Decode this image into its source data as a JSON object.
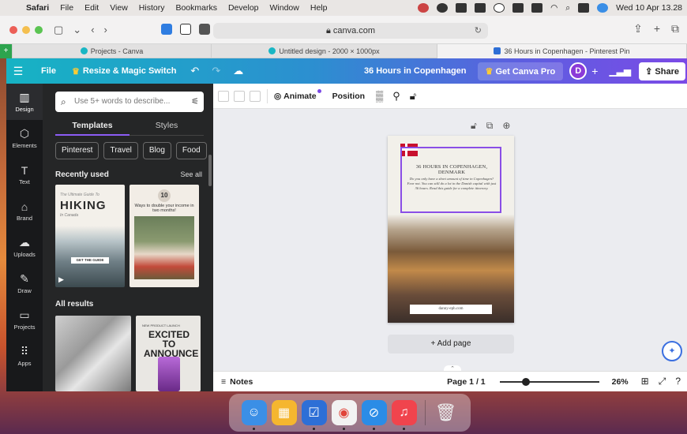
{
  "menubar": {
    "app": "Safari",
    "items": [
      "File",
      "Edit",
      "View",
      "History",
      "Bookmarks",
      "Develop",
      "Window",
      "Help"
    ],
    "clock": "Wed 10 Apr 13.28"
  },
  "safari": {
    "url": "canva.com",
    "tabs": [
      {
        "label": "Projects - Canva",
        "active": false
      },
      {
        "label": "Untitled design - 2000 × 1000px",
        "active": false
      },
      {
        "label": "36 Hours in Copenhagen - Pinterest Pin",
        "active": true
      }
    ]
  },
  "canva_header": {
    "file": "File",
    "resize": "Resize & Magic Switch",
    "doc_title": "36 Hours in Copenhagen",
    "get_pro": "Get Canva Pro",
    "avatar": "D",
    "share": "Share"
  },
  "rail": [
    {
      "icon": "design-icon",
      "label": "Design",
      "active": true
    },
    {
      "icon": "elements-icon",
      "label": "Elements",
      "active": false
    },
    {
      "icon": "text-icon",
      "label": "Text",
      "active": false
    },
    {
      "icon": "brand-icon",
      "label": "Brand",
      "active": false
    },
    {
      "icon": "uploads-icon",
      "label": "Uploads",
      "active": false
    },
    {
      "icon": "draw-icon",
      "label": "Draw",
      "active": false
    },
    {
      "icon": "projects-icon",
      "label": "Projects",
      "active": false
    },
    {
      "icon": "apps-icon",
      "label": "Apps",
      "active": false
    }
  ],
  "panel": {
    "search_placeholder": "Use 5+ words to describe...",
    "tabs": [
      "Templates",
      "Styles"
    ],
    "chips": [
      "Pinterest",
      "Travel",
      "Blog",
      "Food"
    ],
    "recently_used": "Recently used",
    "see_all": "See all",
    "all_results": "All results",
    "hiking": {
      "small": "The Ultimate Guide To",
      "big": "HIKING",
      "loc": "In Canada",
      "btn": "GET THE GUIDE"
    },
    "ways": {
      "num": "10",
      "text": "Ways to double your income in two months!"
    },
    "excited": {
      "small": "NEW PRODUCT LAUNCH",
      "big": "EXCITED TO ANNOUNCE"
    }
  },
  "toolbar": {
    "animate": "Animate",
    "position": "Position"
  },
  "design": {
    "title": "36 HOURS IN COPENHAGEN, DENMARK",
    "body": "Do you only have a short amount of time in Copenhagen? Fear not. You can still do a lot in the Danish capital with just 36 hours. Read this guide for a complete itinerary.",
    "url": "danny-eph.com"
  },
  "add_page": "+ Add page",
  "footer": {
    "notes": "Notes",
    "page": "Page 1 / 1",
    "zoom": "26%",
    "zoom_fraction": 0.26
  }
}
